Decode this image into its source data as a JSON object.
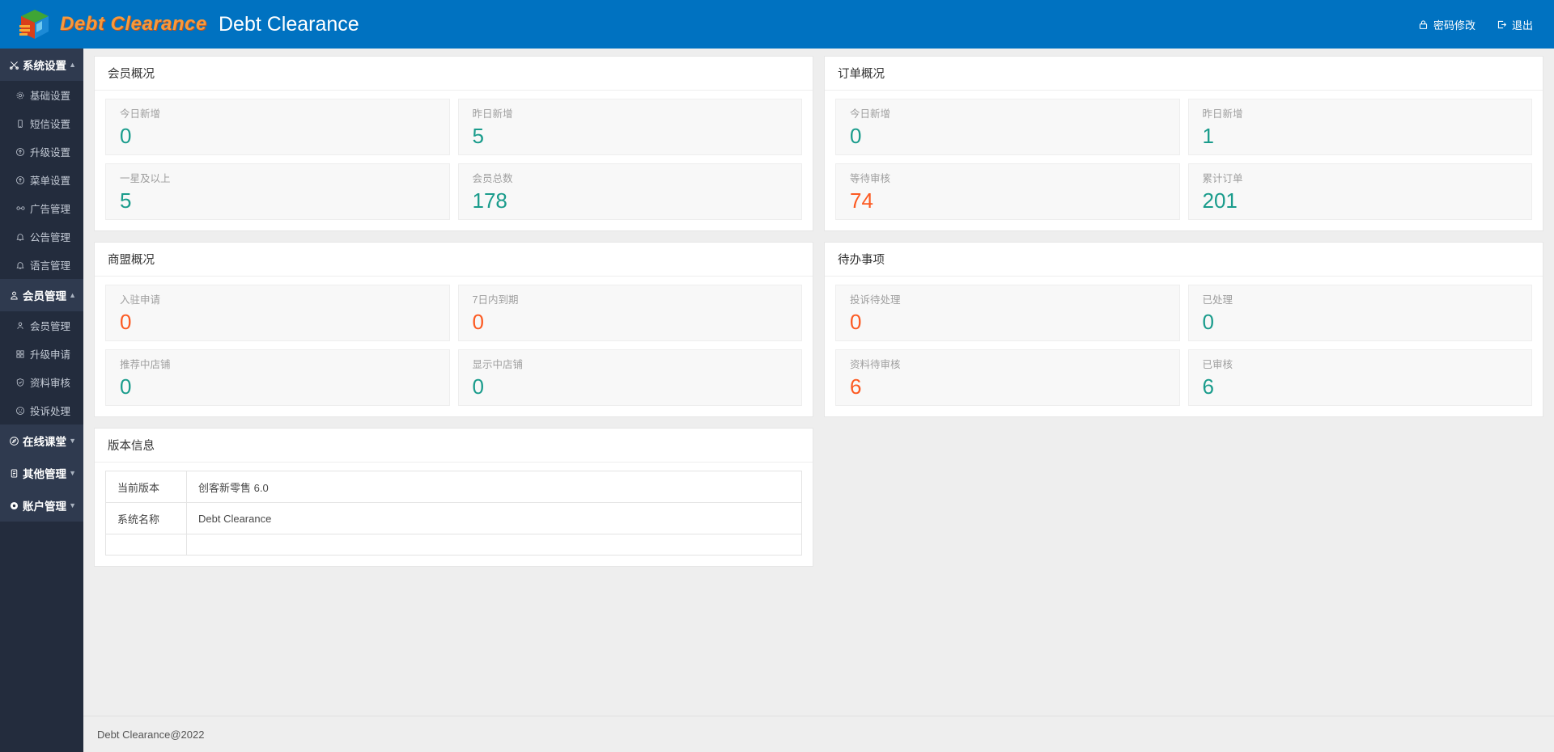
{
  "header": {
    "brand_text": "Debt Clearance",
    "title": "Debt Clearance",
    "change_password": "密码修改",
    "logout": "退出",
    "accent": "#0072c1",
    "brand_color": "#f79a3c"
  },
  "sidebar": {
    "groups": [
      {
        "label": "系统设置",
        "icon": "scissors-icon",
        "active": true,
        "items": [
          {
            "label": "基础设置",
            "icon": "gear-icon"
          },
          {
            "label": "短信设置",
            "icon": "mobile-icon"
          },
          {
            "label": "升级设置",
            "icon": "upload-circle-icon"
          },
          {
            "label": "菜单设置",
            "icon": "upload-circle-icon"
          },
          {
            "label": "广告管理",
            "icon": "glasses-icon"
          },
          {
            "label": "公告管理",
            "icon": "bell-icon"
          },
          {
            "label": "语言管理",
            "icon": "bell-icon"
          }
        ]
      },
      {
        "label": "会员管理",
        "icon": "user-badge-icon",
        "active": true,
        "items": [
          {
            "label": "会员管理",
            "icon": "user-icon"
          },
          {
            "label": "升级申请",
            "icon": "grid-icon"
          },
          {
            "label": "资料审核",
            "icon": "shield-check-icon"
          },
          {
            "label": "投诉处理",
            "icon": "sad-face-icon"
          }
        ]
      },
      {
        "label": "在线课堂",
        "icon": "compass-icon",
        "active": false,
        "items": []
      },
      {
        "label": "其他管理",
        "icon": "file-icon",
        "active": false,
        "items": []
      },
      {
        "label": "账户管理",
        "icon": "gear-icon",
        "active": false,
        "items": []
      }
    ]
  },
  "cards": {
    "member_overview": {
      "title": "会员概况",
      "tiles": [
        {
          "label": "今日新增",
          "value": "0",
          "color": "teal"
        },
        {
          "label": "昨日新增",
          "value": "5",
          "color": "teal"
        },
        {
          "label": "一星及以上",
          "value": "5",
          "color": "teal"
        },
        {
          "label": "会员总数",
          "value": "178",
          "color": "teal"
        }
      ]
    },
    "order_overview": {
      "title": "订单概况",
      "tiles": [
        {
          "label": "今日新增",
          "value": "0",
          "color": "teal"
        },
        {
          "label": "昨日新增",
          "value": "1",
          "color": "teal"
        },
        {
          "label": "等待审核",
          "value": "74",
          "color": "red"
        },
        {
          "label": "累计订单",
          "value": "201",
          "color": "teal"
        }
      ]
    },
    "alliance_overview": {
      "title": "商盟概况",
      "tiles": [
        {
          "label": "入驻申请",
          "value": "0",
          "color": "red"
        },
        {
          "label": "7日内到期",
          "value": "0",
          "color": "red"
        },
        {
          "label": "推荐中店铺",
          "value": "0",
          "color": "teal"
        },
        {
          "label": "显示中店铺",
          "value": "0",
          "color": "teal"
        }
      ]
    },
    "todo": {
      "title": "待办事项",
      "tiles": [
        {
          "label": "投诉待处理",
          "value": "0",
          "color": "red"
        },
        {
          "label": "已处理",
          "value": "0",
          "color": "teal"
        },
        {
          "label": "资料待审核",
          "value": "6",
          "color": "red"
        },
        {
          "label": "已审核",
          "value": "6",
          "color": "teal"
        }
      ]
    },
    "version_info": {
      "title": "版本信息",
      "rows": [
        {
          "key": "当前版本",
          "value": "创客新零售 6.0"
        },
        {
          "key": "系统名称",
          "value": "Debt Clearance"
        },
        {
          "key": "",
          "value": ""
        }
      ]
    }
  },
  "footer": {
    "text": "Debt Clearance@2022"
  }
}
